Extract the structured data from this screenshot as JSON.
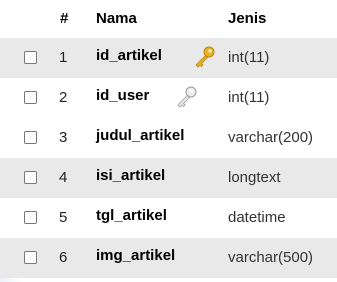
{
  "header": {
    "num_label": "#",
    "name_label": "Nama",
    "type_label": "Jenis"
  },
  "rows": [
    {
      "num": "1",
      "name": "id_artikel",
      "type": "int(11)",
      "key": "primary-key-icon"
    },
    {
      "num": "2",
      "name": "id_user",
      "type": "int(11)",
      "key": "index-key-icon"
    },
    {
      "num": "3",
      "name": "judul_artikel",
      "type": "varchar(200)"
    },
    {
      "num": "4",
      "name": "isi_artikel",
      "type": "longtext"
    },
    {
      "num": "5",
      "name": "tgl_artikel",
      "type": "datetime"
    },
    {
      "num": "6",
      "name": "img_artikel",
      "type": "varchar(500)"
    }
  ],
  "colors": {
    "row_alt": "#e9e9e9",
    "primary_key": "#e7b128",
    "index_key": "#b5b5b5"
  }
}
